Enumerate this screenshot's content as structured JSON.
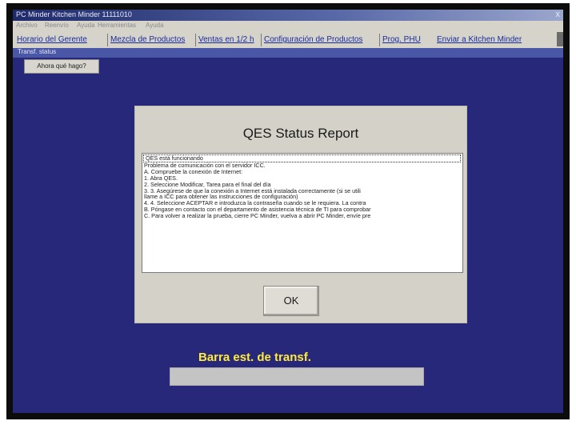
{
  "window": {
    "title": "PC Minder Kitchen Minder 11111010",
    "close": "x"
  },
  "menu": [
    {
      "label": "Archivo"
    },
    {
      "label": "Reenvío"
    },
    {
      "label": "Ayuda"
    },
    {
      "label": "Herramientas"
    },
    {
      "label": "Ayuda"
    }
  ],
  "tabs": [
    {
      "label": "Horario del Gerente"
    },
    {
      "label": "Mezcla de Productos"
    },
    {
      "label": "Ventas en 1/2 h"
    },
    {
      "label": "Configuración de Productos"
    },
    {
      "label": "Prog. PHU"
    },
    {
      "label": "Enviar a Kitchen Minder"
    }
  ],
  "subbar": {
    "label": "Transf. status"
  },
  "subtab": {
    "label": "Ahora qué hago?"
  },
  "dialog": {
    "title": "QES Status Report",
    "lines": [
      "QES está funcionando",
      "Problema de comunicación con el servidor ICC.",
      "A. Compruebe la conexión de Internet:",
      "   1. Abra QES.",
      "   2. Seleccione Modificar, Tarea para el final del día",
      "3.     3. Asegúrese de que la conexión a Internet está instalada correctamente (si se utili",
      "llame a ICC para obtener las instrucciones de configuración)",
      "4.     4. Seleccione ACEPTAR e introduzca la contraseña cuando se le requiera. La contra",
      "B. Póngase en contacto con el departamento de asistencia técnica de TI para comprobar",
      "C. Para volver a realizar la prueba, cierre PC Minder, vuelva a abrir PC Minder, envíe pre"
    ],
    "ok": "OK"
  },
  "status": {
    "label": "Barra est. de transf."
  }
}
